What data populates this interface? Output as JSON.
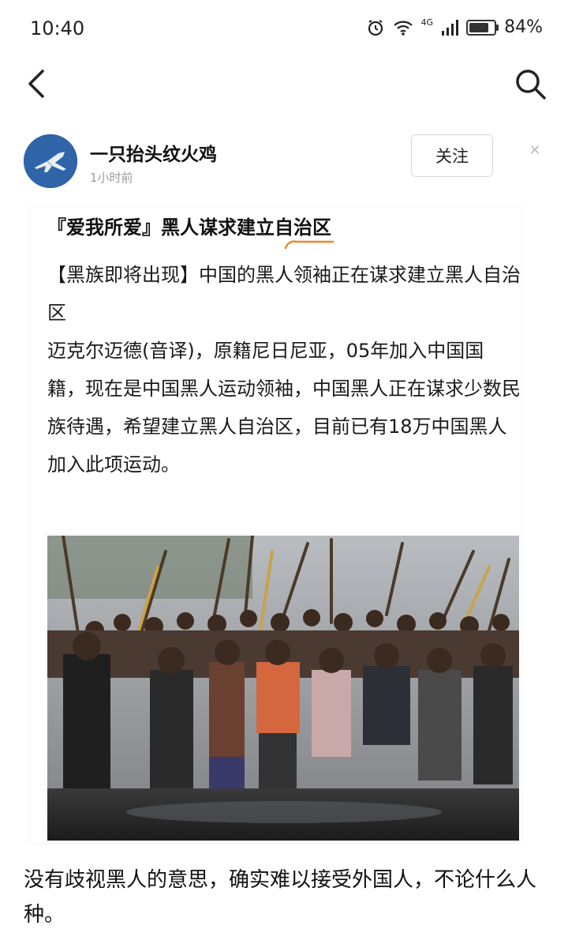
{
  "status_bar": {
    "time": "10:40",
    "network": "4G",
    "battery_percent": "84%",
    "battery_level": 0.84,
    "icons": [
      "alarm-icon",
      "wifi-icon",
      "signal-icon",
      "battery-icon"
    ]
  },
  "nav": {
    "back_icon": "chevron-left-icon",
    "search_icon": "search-icon"
  },
  "author": {
    "name": "一只抬头纹火鸡",
    "time": "1小时前",
    "follow_label": "关注",
    "close_label": "✕",
    "avatar_icon": "fighter-jet-icon"
  },
  "post": {
    "title": "『爱我所爱』黑人谋求建立自治区",
    "paragraphs": [
      "【黑族即将出现】中国的黑人领袖正在谋求建立黑人自治区",
      "迈克尔迈德(音译)，原籍尼日尼亚，05年加入中国国籍，现在是中国黑人运动领袖，中国黑人正在谋求少数民族待遇，希望建立黑人自治区，目前已有18万中国黑人加入此项运动。"
    ],
    "image_icon": "crowd-photo"
  },
  "comment": {
    "text": "没有歧视黑人的意思，确实难以接受外国人，不论什么人种。"
  },
  "colors": {
    "accent_underline": "#e8882c",
    "avatar_bg": "#2f64a8",
    "muted_text": "#9a9a9a"
  }
}
